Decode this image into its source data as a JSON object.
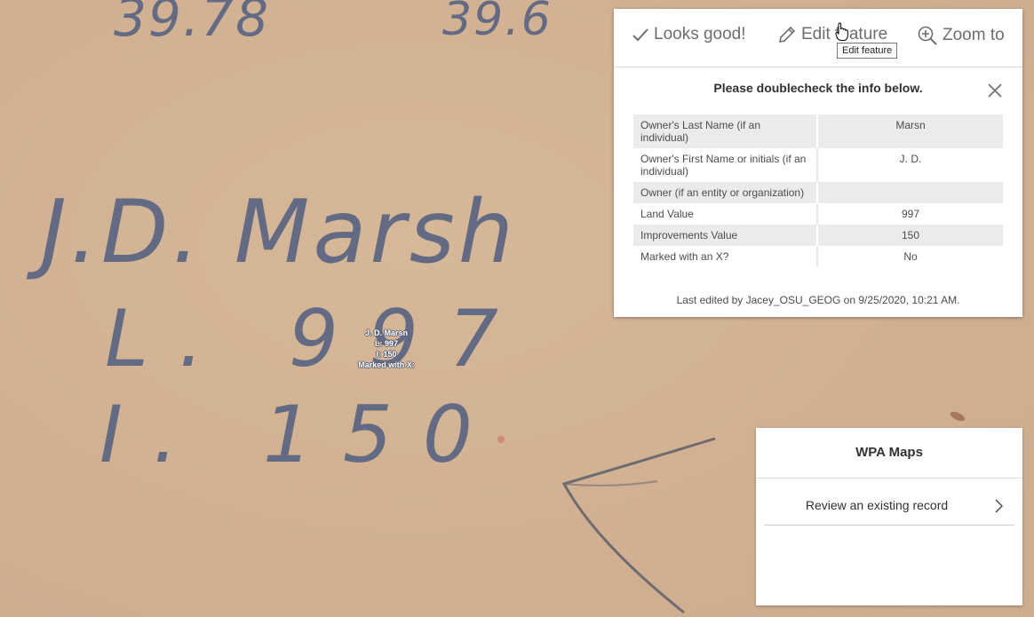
{
  "map": {
    "handwriting": {
      "top_left_number": "39.78",
      "top_mid_number": "39.6",
      "name": "J.D. Marsh",
      "land_line": "L. 997",
      "improvements_line": "I. 150"
    },
    "feature_label": {
      "line1": "J. D.  Marsn",
      "line2": "L: 997",
      "line3": "I: 150",
      "line4": "Marked with X:"
    }
  },
  "popup": {
    "actions": {
      "looks_good": "Looks good!",
      "edit_feature": "Edit feature",
      "zoom_to": "Zoom to"
    },
    "tooltip": "Edit feature",
    "title": "Please doublecheck the info below.",
    "fields": [
      {
        "label": "Owner's Last Name (if an individual)",
        "value": "Marsn"
      },
      {
        "label": "Owner's First Name or initials (if an individual)",
        "value": "J. D."
      },
      {
        "label": "Owner (if an entity or organization)",
        "value": ""
      },
      {
        "label": "Land Value",
        "value": "997"
      },
      {
        "label": "Improvements Value",
        "value": "150"
      },
      {
        "label": "Marked with an X?",
        "value": "No"
      }
    ],
    "last_edited": "Last edited by Jacey_OSU_GEOG on 9/25/2020, 10:21 AM."
  },
  "panel": {
    "title": "WPA Maps",
    "item": "Review an existing record"
  },
  "colors": {
    "map_background": "#d2b394",
    "handwriting_ink": "#636b84"
  }
}
